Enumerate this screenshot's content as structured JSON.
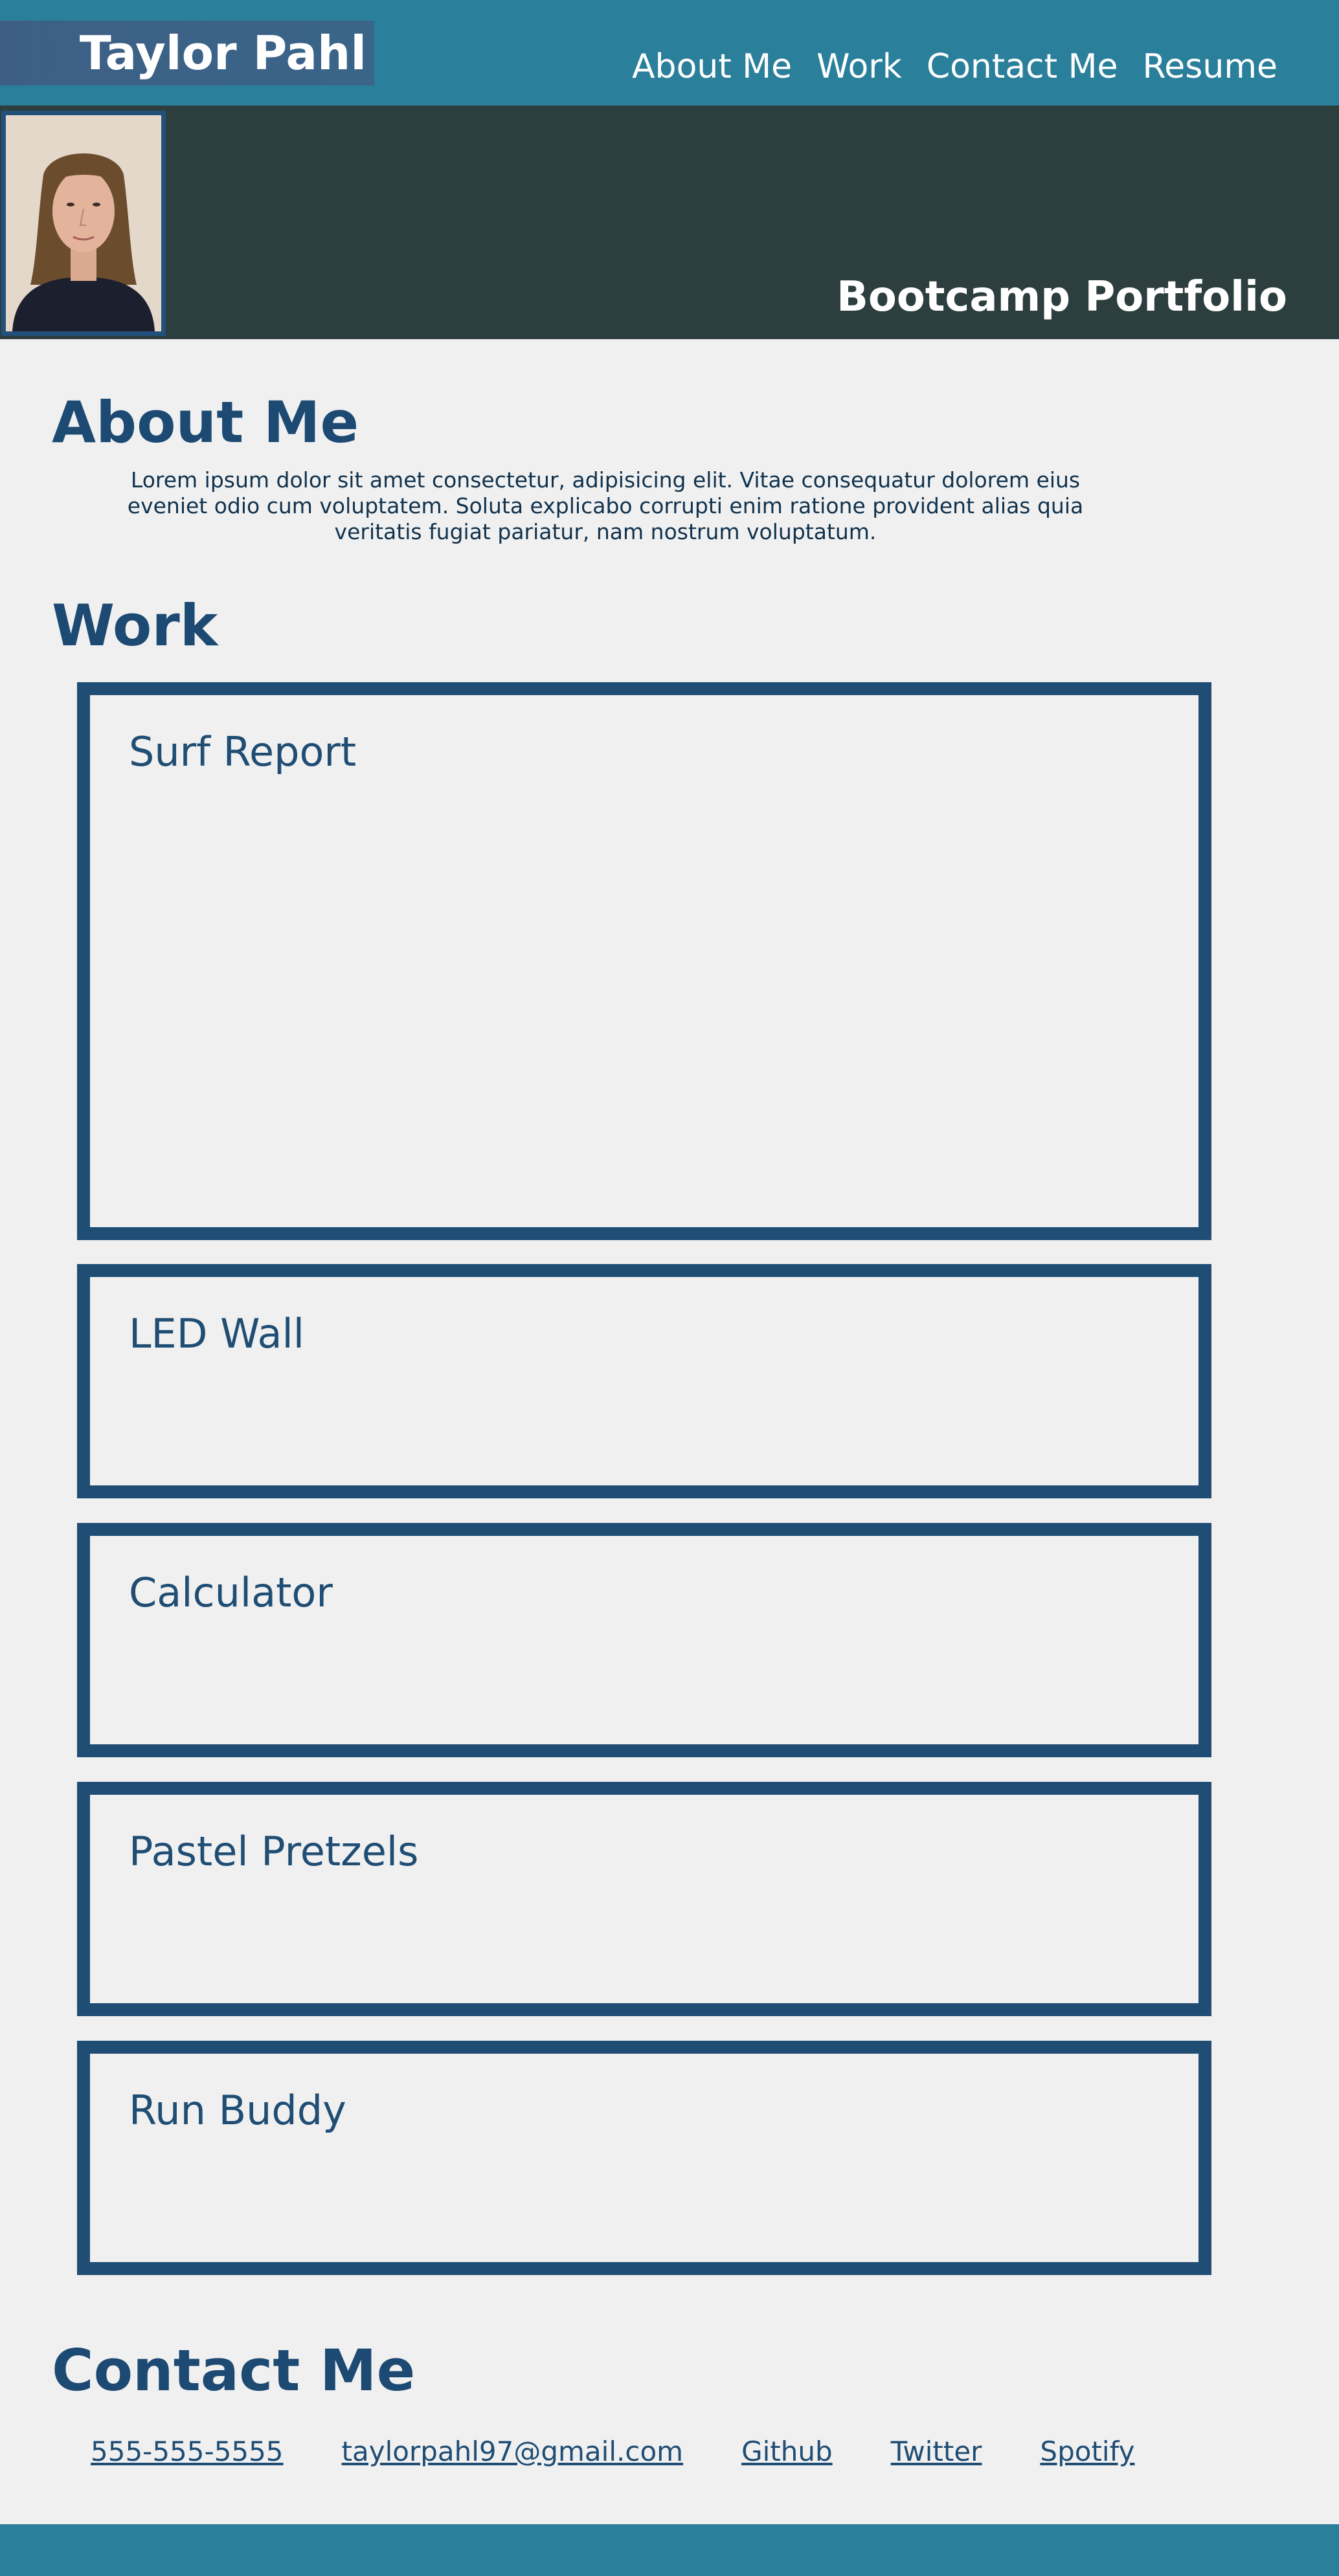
{
  "header": {
    "brand": "Taylor Pahl",
    "nav": [
      "About Me",
      "Work",
      "Contact Me",
      "Resume"
    ]
  },
  "hero": {
    "title": "Bootcamp Portfolio"
  },
  "about": {
    "title": "About Me",
    "text": "Lorem ipsum dolor sit amet consectetur, adipisicing elit. Vitae consequatur dolorem eius eveniet odio cum voluptatem. Soluta explicabo corrupti enim ratione provident alias quia veritatis fugiat pariatur, nam nostrum voluptatum."
  },
  "work": {
    "title": "Work",
    "projects": [
      "Surf Report",
      "LED Wall",
      "Calculator",
      "Pastel Pretzels",
      "Run Buddy"
    ]
  },
  "contact": {
    "title": "Contact Me",
    "links": [
      "555-555-5555",
      "taylorpahl97@gmail.com",
      "Github",
      "Twitter",
      "Spotify"
    ]
  },
  "colors": {
    "header_bg": "#2a7f9b",
    "hero_bg": "#2d3e3e",
    "accent": "#1f4d74",
    "page_bg": "#f0f0f0"
  }
}
